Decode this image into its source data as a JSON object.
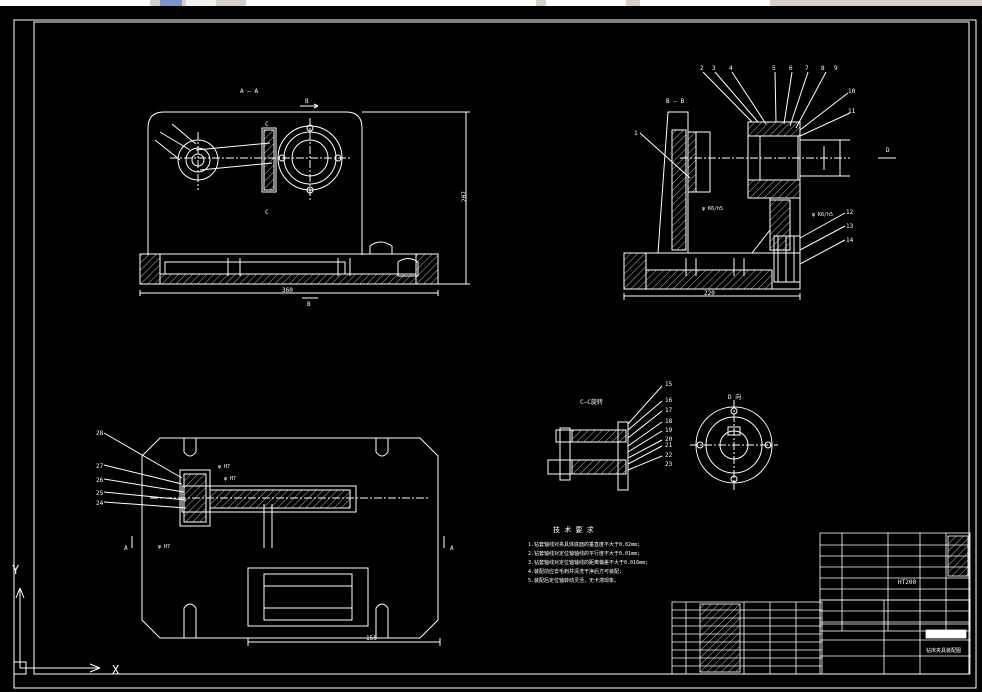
{
  "views": {
    "aa_label": "A — A",
    "bb_label": "B — B",
    "cc_label": "C—C旋转",
    "d_view_label": "D 向",
    "d_arrow": "D",
    "b_mark": "B",
    "c_mark": "C",
    "a_mark": "A"
  },
  "dimensions": {
    "width_360": "360",
    "height_207": "207",
    "width_220": "220",
    "width_155": "155",
    "fit_k6h5": "φ K6/h5",
    "fit_k6h5_b": "φ K6/h5",
    "fit_h7_a": "φ H7",
    "fit_h7_b": "φ H7",
    "fit_h7_c": "φ H7"
  },
  "balloons": [
    "1",
    "2",
    "3",
    "4",
    "5",
    "6",
    "7",
    "8",
    "9",
    "10",
    "11",
    "12",
    "13",
    "14",
    "15",
    "16",
    "17",
    "18",
    "19",
    "20",
    "21",
    "22",
    "23",
    "24",
    "25",
    "26",
    "27",
    "28"
  ],
  "tech_requirements": {
    "title": "技 术 要 求",
    "lines": [
      "1.钻套轴线对夹具体底面的垂直度不大于0.02mm;",
      "2.钻套轴线对定位轴轴线的平行度不大于0.01mm;",
      "3.钻套轴线对定位轴轴线的距离偏差不大于0.016mm;",
      "4.装配前应去毛刺并清洗干净后方可装配;",
      "5.装配后定位轴转动灵活，无卡滞现象。"
    ]
  },
  "title_block": {
    "material_ht200": "HT200",
    "drawing_title": "钻床夹具装配图"
  },
  "ucs": {
    "x": "X",
    "y": "Y"
  },
  "colors": {
    "line": "#ffffff",
    "background": "#000000"
  }
}
